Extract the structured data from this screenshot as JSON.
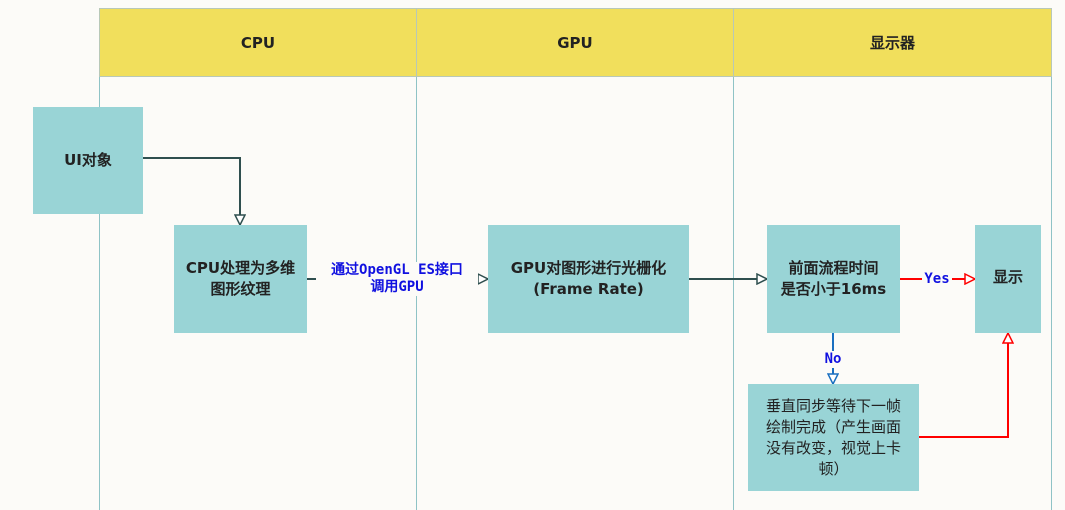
{
  "lanes": {
    "cpu": "CPU",
    "gpu": "GPU",
    "display": "显示器"
  },
  "nodes": {
    "ui_object": "UI对象",
    "cpu_process": "CPU处理为多维图形纹理",
    "gpu_raster": "GPU对图形进行光栅化",
    "gpu_raster_sub": "(Frame Rate)",
    "decision_l1": "前面流程时间",
    "decision_l2": "是否小于16ms",
    "show": "显示",
    "vsync": "垂直同步等待下一帧绘制完成（产生画面没有改变，视觉上卡顿）"
  },
  "edges": {
    "cpu_to_gpu_l1": "通过OpenGL ES接口",
    "cpu_to_gpu_l2": "调用GPU",
    "yes": "Yes",
    "no": "No"
  },
  "colors": {
    "header": "#f1df5c",
    "node": "#99d4d6",
    "yes_edge": "#ff0000",
    "no_edge": "#1a6fc0",
    "edge": "#2f4f4f"
  }
}
